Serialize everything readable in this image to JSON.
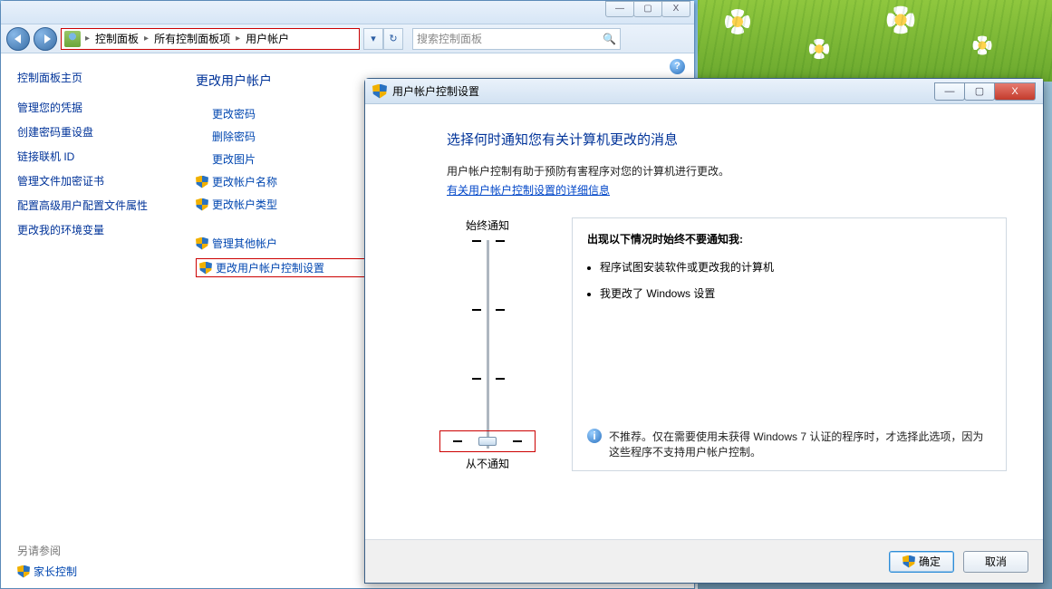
{
  "parentWindow": {
    "winButtons": {
      "min": "—",
      "max": "▢",
      "close": "X"
    },
    "nav": {
      "breadcrumb": [
        "控制面板",
        "所有控制面板项",
        "用户帐户"
      ],
      "refreshGlyph": "↻",
      "dropGlyph": "▾",
      "searchPlaceholder": "搜索控制面板"
    },
    "helpGlyph": "?",
    "sidebar": {
      "home": "控制面板主页",
      "links": [
        "管理您的凭据",
        "创建密码重设盘",
        "链接联机 ID",
        "管理文件加密证书",
        "配置高级用户配置文件属性",
        "更改我的环境变量"
      ],
      "seeAlsoLabel": "另请参阅",
      "seeAlsoLink": "家长控制"
    },
    "content": {
      "heading": "更改用户帐户",
      "actions": [
        {
          "label": "更改密码",
          "shield": false
        },
        {
          "label": "删除密码",
          "shield": false
        },
        {
          "label": "更改图片",
          "shield": false
        },
        {
          "label": "更改帐户名称",
          "shield": true
        },
        {
          "label": "更改帐户类型",
          "shield": true
        }
      ],
      "actionsGroup2": [
        {
          "label": "管理其他帐户",
          "shield": true
        },
        {
          "label": "更改用户帐户控制设置",
          "shield": true,
          "highlight": true
        }
      ]
    }
  },
  "uacDialog": {
    "title": "用户帐户控制设置",
    "winButtons": {
      "min": "—",
      "max": "▢",
      "close": "X"
    },
    "heading": "选择何时通知您有关计算机更改的消息",
    "desc": "用户帐户控制有助于预防有害程序对您的计算机进行更改。",
    "detailsLink": "有关用户帐户控制设置的详细信息",
    "slider": {
      "topLabel": "始终通知",
      "bottomLabel": "从不通知"
    },
    "panel": {
      "whenTitle": "出现以下情况时始终不要通知我:",
      "bullets": [
        "程序试图安装软件或更改我的计算机",
        "我更改了 Windows 设置"
      ],
      "note": "不推荐。仅在需要使用未获得 Windows 7 认证的程序时，才选择此选项，因为这些程序不支持用户帐户控制。",
      "noteIconGlyph": "i"
    },
    "buttons": {
      "ok": "确定",
      "cancel": "取消"
    }
  }
}
